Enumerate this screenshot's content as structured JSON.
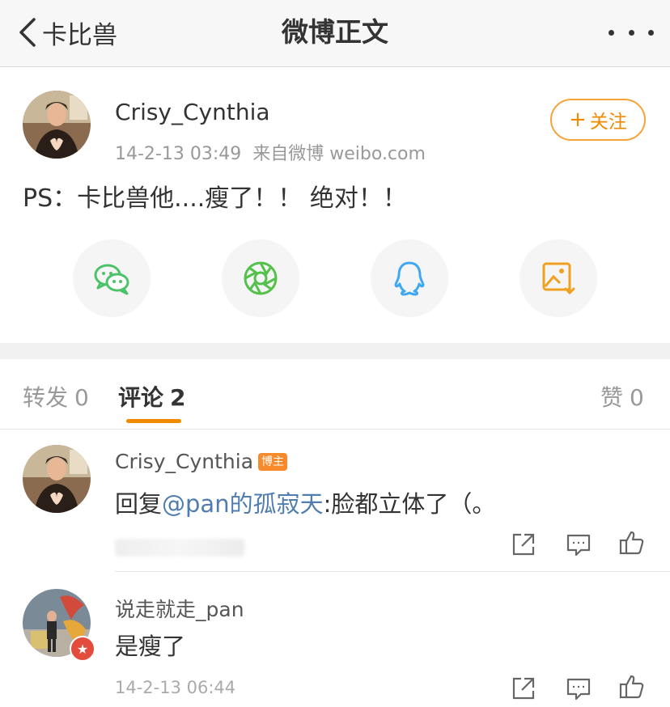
{
  "nav": {
    "back_label": "卡比兽",
    "title": "微博正文"
  },
  "post": {
    "author": "Crisy_Cynthia",
    "time": "14-2-13 03:49",
    "source": "来自微博 weibo.com",
    "follow_label": "关注",
    "follow_plus": "+",
    "text": "PS：卡比兽他....瘦了！！ 绝对！！"
  },
  "share": {
    "items": [
      {
        "icon": "wechat-icon",
        "color": "#4cc269"
      },
      {
        "icon": "moments-icon",
        "color": "#54c14b"
      },
      {
        "icon": "qq-icon",
        "color": "#3fa8f0"
      },
      {
        "icon": "save-image-icon",
        "color": "#f0a020"
      }
    ]
  },
  "tabs": {
    "repost_label": "转发",
    "repost_count": "0",
    "comment_label": "评论",
    "comment_count": "2",
    "like_label": "赞",
    "like_count": "0"
  },
  "comments": [
    {
      "author": "Crisy_Cynthia",
      "badge": "博主",
      "prefix": "回复",
      "mention": "@pan的孤寂天",
      "text": ":脸都立体了（。"
    },
    {
      "author": "说走就走_pan",
      "text": "是瘦了",
      "time": "14-2-13 06:44",
      "verified_badge": "★"
    }
  ],
  "colors": {
    "accent": "#f08a00",
    "mention": "#507daf",
    "badge": "#f78a2a"
  }
}
